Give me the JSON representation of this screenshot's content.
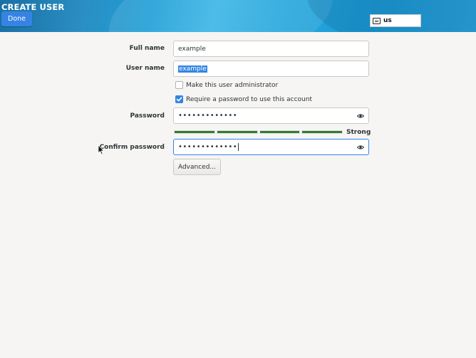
{
  "header": {
    "title": "CREATE USER",
    "done_label": "Done",
    "keyboard_layout": "us"
  },
  "form": {
    "full_name": {
      "label": "Full name",
      "value": "example"
    },
    "user_name": {
      "label": "User name",
      "value": "example"
    },
    "admin_checkbox": {
      "label": "Make this user administrator",
      "checked": false
    },
    "require_password_checkbox": {
      "label": "Require a password to use this account",
      "checked": true
    },
    "password": {
      "label": "Password",
      "masked_value": "•••••••••••••"
    },
    "strength": {
      "label": "Strong",
      "level": 4,
      "max": 4
    },
    "confirm_password": {
      "label": "Confirm password",
      "masked_value": "•••••••••••••"
    },
    "advanced_label": "Advanced..."
  },
  "colors": {
    "accent": "#3584e4",
    "strength_bar": "#2f7d32",
    "background": "#f6f5f4"
  },
  "icons": {
    "keyboard": "keyboard-icon",
    "reveal": "eye-icon",
    "check": "checkmark-icon",
    "cursor": "mouse-pointer-icon"
  }
}
